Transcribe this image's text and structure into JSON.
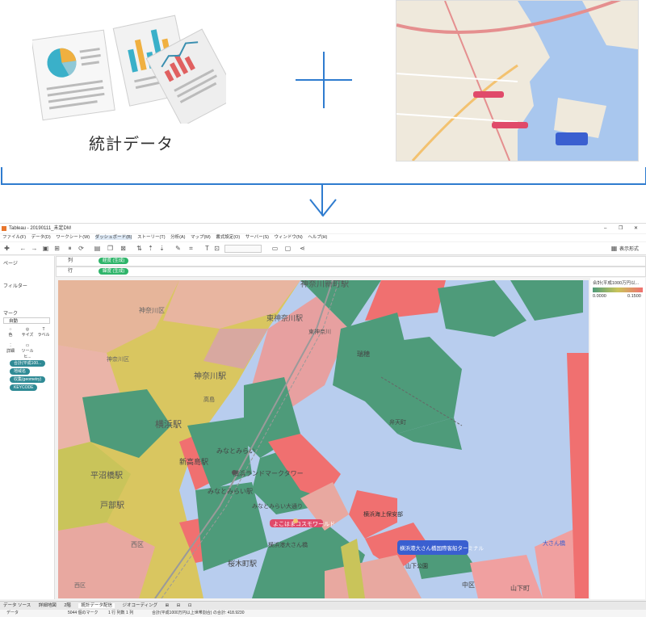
{
  "illustration": {
    "stats_label": "統計データ"
  },
  "app": {
    "title": "Tableau - 20190111_未定DM",
    "window_controls": [
      "–",
      "❐",
      "✕"
    ],
    "menu": [
      "ファイル(F)",
      "データ(D)",
      "ワークシート(W)",
      "ダッシュボード(B)",
      "ストーリー(T)",
      "分析(A)",
      "マップ(M)",
      "書式設定(O)",
      "サーバー(S)",
      "ウィンドウ(N)",
      "ヘルプ(H)"
    ],
    "show_me": "表示形式",
    "pages_label": "ページ",
    "filters_label": "フィルター",
    "marks_label": "マーク",
    "marks_type": "自動",
    "marks_buttons": [
      "色",
      "サイズ",
      "ラベル",
      "詳細",
      "ツールヒ..."
    ],
    "marks_pills": [
      "合計(平成100...",
      "地域名",
      "収集(geometry)",
      "KEYCODE"
    ],
    "columns_label": "列",
    "rows_label": "行",
    "columns_pill": "経度 (生成)",
    "rows_pill": "緯度 (生成)",
    "legend_title": "合計(平成1000万円以...",
    "legend_min": "0.0000",
    "legend_max": "0.1500",
    "bottom_tabs": [
      "データ ソース",
      "詳細地図",
      "2階",
      "統計データ配信",
      "ジオコーディング"
    ],
    "status": {
      "left": "データ",
      "marks": "5044 個のマーク",
      "rows_cols": "1 行 列数 1 列",
      "sum": "合計(平成1000万円以上世帯割合) の合計: 418.9230"
    }
  },
  "map_labels": {
    "kanagawa_shinmachi": "神奈川新町駅",
    "higashi_kanagawa": "東神奈川駅",
    "kanagawa_st": "神奈川駅",
    "yokohama": "横浜駅",
    "shin_takashima": "新高島駅",
    "minatomirai": "みなとみらい",
    "minatomirai_st": "みなとみらい駅",
    "hiranuma": "平沼橋駅",
    "tobe": "戸部駅",
    "sakuragicho": "桜木町駅",
    "landmark": "横浜ランドマークタワー",
    "cosmo": "よこはまコスモワールド",
    "osanbashi": "横浜港大さん橋国際客船ターミナル",
    "yamashita": "山下町",
    "mizuho": "瑞穂",
    "kanagawa_ku": "神奈川区",
    "nishi_ku": "西区",
    "naka_ku": "中区",
    "coast_guard": "横浜海上保安部",
    "yamashita_park": "山下公園",
    "osanbashi_short": "大さん橋",
    "osanbashi_pier": "横浜港大さん橋",
    "kanagawa_ku_2": "神奈川区",
    "minatomirai_road": "みなとみらい大通り",
    "benten": "弁天町",
    "nishi_ku_2": "西区",
    "higashi_kanagawa_2": "東神奈川",
    "takashima": "高島"
  },
  "colors": {
    "accent_blue": "#2f7ccf",
    "water": "#b8cdee",
    "green": "#4e9b7a",
    "yellow": "#c9c45a",
    "pink": "#f0a6a6",
    "red": "#f07070"
  }
}
